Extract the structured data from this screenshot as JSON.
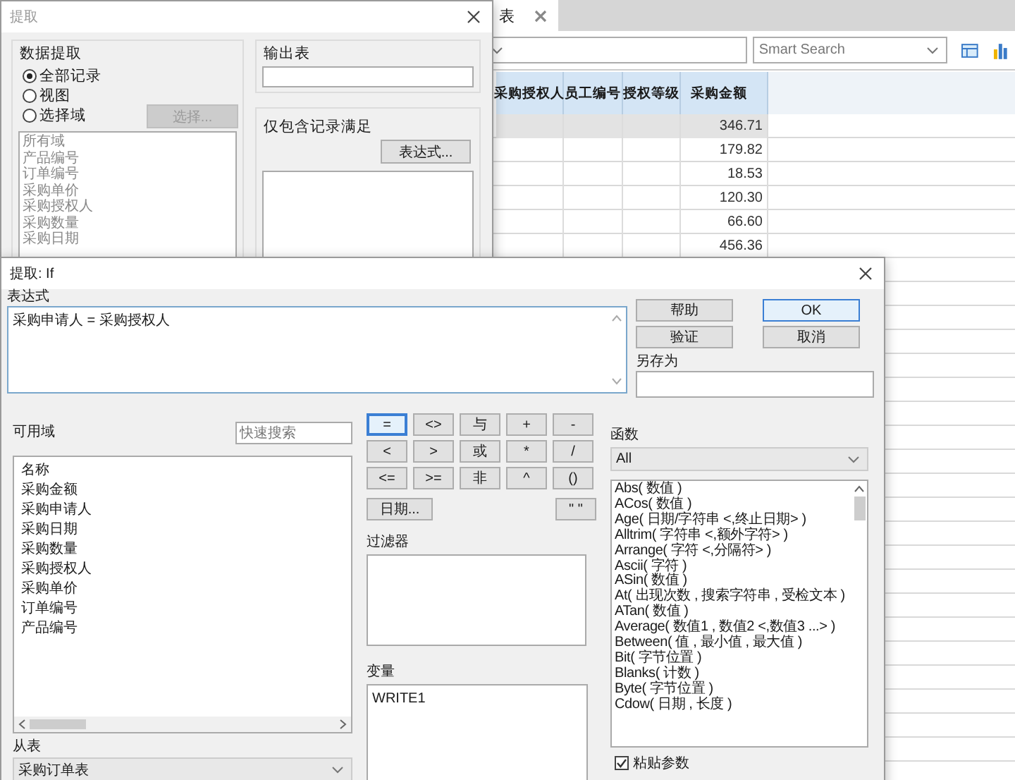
{
  "background_app": {
    "tab": {
      "label": "表"
    },
    "toolbar": {
      "smart_search": {
        "placeholder": "Smart Search"
      }
    },
    "table": {
      "columns": [
        "采购授权人",
        "员工编号",
        "授权等级",
        "采购金额"
      ],
      "rows": [
        {
          "amount": "346.71",
          "selected": true
        },
        {
          "amount": "179.82",
          "selected": false
        },
        {
          "amount": "18.53",
          "selected": false
        },
        {
          "amount": "120.30",
          "selected": false
        },
        {
          "amount": "66.60",
          "selected": false
        },
        {
          "amount": "456.36",
          "selected": false
        }
      ]
    }
  },
  "extract_dialog": {
    "title": "提取",
    "data_extract": {
      "legend": "数据提取",
      "options": [
        {
          "label": "全部记录",
          "selected": true
        },
        {
          "label": "视图",
          "selected": false
        },
        {
          "label": "选择域",
          "selected": false
        }
      ],
      "select_button": {
        "label": "选择...",
        "disabled": true
      },
      "fields": [
        "所有域",
        "产品编号",
        "订单编号",
        "采购单价",
        "采购授权人",
        "采购数量",
        "采购日期"
      ]
    },
    "output": {
      "legend": "输出表"
    },
    "condition": {
      "legend": "仅包含记录满足",
      "button": "表达式..."
    }
  },
  "if_dialog": {
    "title": "提取: If",
    "expression_label": "表达式",
    "expression": "采购申请人 = 采购授权人",
    "buttons": [
      {
        "label": "帮助",
        "default": false
      },
      {
        "label": "OK",
        "default": true
      },
      {
        "label": "验证",
        "default": false
      },
      {
        "label": "取消",
        "default": false
      }
    ],
    "save_as_label": "另存为",
    "fields_label": "可用域",
    "quick_search": {
      "placeholder": "快速搜索"
    },
    "fields": [
      "名称",
      "采购金额",
      "采购申请人",
      "采购日期",
      "采购数量",
      "采购授权人",
      "采购单价",
      "订单编号",
      "产品编号"
    ],
    "from_table_label": "从表",
    "from_table": "采购订单表",
    "operators": [
      {
        "label": "=",
        "selected": true
      },
      {
        "label": "<>",
        "selected": false
      },
      {
        "label": "与",
        "selected": false
      },
      {
        "label": "+",
        "selected": false
      },
      {
        "label": "-",
        "selected": false
      },
      {
        "label": "<",
        "selected": false
      },
      {
        "label": ">",
        "selected": false
      },
      {
        "label": "或",
        "selected": false
      },
      {
        "label": "*",
        "selected": false
      },
      {
        "label": "/",
        "selected": false
      },
      {
        "label": "<=",
        "selected": false
      },
      {
        "label": ">=",
        "selected": false
      },
      {
        "label": "非",
        "selected": false
      },
      {
        "label": "^",
        "selected": false
      },
      {
        "label": "()",
        "selected": false
      }
    ],
    "date_button": "日期...",
    "quote_button": "\" \"",
    "filter_label": "过滤器",
    "variables_label": "变量",
    "variables": [
      "WRITE1"
    ],
    "functions_label": "函数",
    "function_category": "All",
    "functions": [
      "Abs( 数值 )",
      "ACos( 数值 )",
      "Age( 日期/字符串 <,终止日期> )",
      "Alltrim( 字符串 <,额外字符> )",
      "Arrange( 字符 <,分隔符> )",
      "Ascii( 字符 )",
      "ASin( 数值 )",
      "At( 出现次数 , 搜索字符串 , 受检文本 )",
      "ATan( 数值 )",
      "Average( 数值1 , 数值2 <,数值3 ...> )",
      "Between( 值 , 最小值 , 最大值 )",
      "Bit( 字节位置 )",
      "Blanks( 计数 )",
      "Byte( 字节位置 )",
      "Cdow( 日期 , 长度 )"
    ],
    "paste_params": {
      "label": "粘贴参数",
      "checked": true
    }
  }
}
